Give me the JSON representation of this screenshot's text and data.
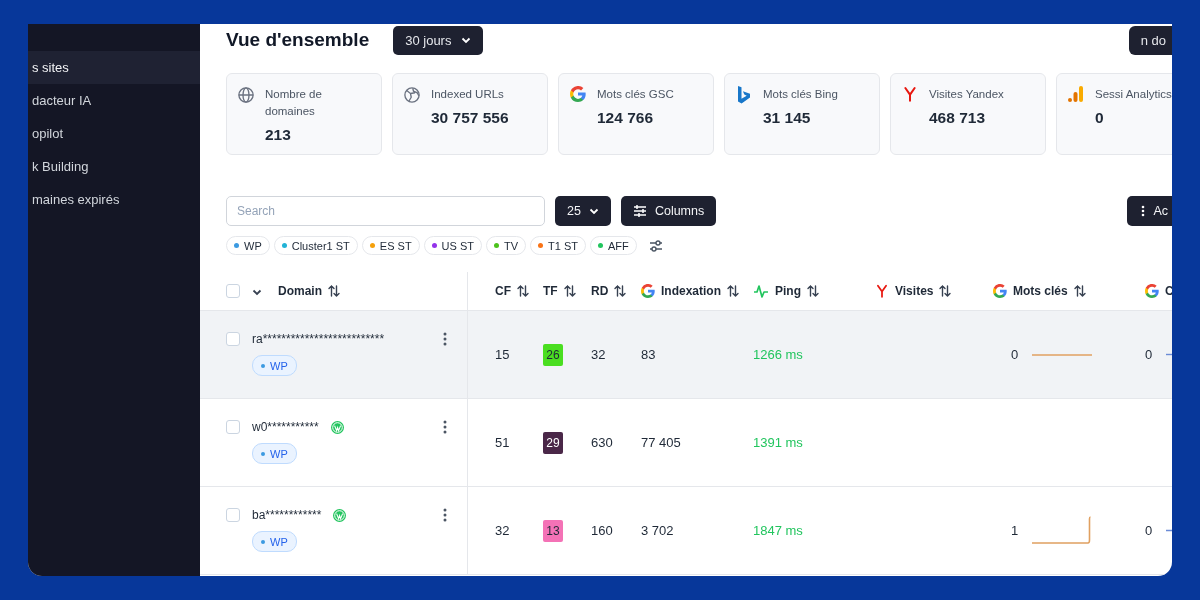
{
  "sidebar": {
    "items": [
      {
        "label": "s sites",
        "selected": true
      },
      {
        "label": "dacteur IA",
        "selected": false
      },
      {
        "label": "opilot",
        "selected": false
      },
      {
        "label": "k Building",
        "selected": false
      },
      {
        "label": "maines expirés",
        "selected": false
      }
    ]
  },
  "header": {
    "title": "Vue d'ensemble",
    "period": "30 jours",
    "right_button": "n do"
  },
  "stats": [
    {
      "kind": "globe",
      "label": "Nombre de domaines",
      "value": "213"
    },
    {
      "kind": "web",
      "label": "Indexed URLs",
      "value": "30 757 556"
    },
    {
      "kind": "google",
      "label": "Mots clés GSC",
      "value": "124 766"
    },
    {
      "kind": "bing",
      "label": "Mots clés Bing",
      "value": "31 145"
    },
    {
      "kind": "yandex",
      "label": "Visites Yandex",
      "value": "468 713"
    },
    {
      "kind": "analytics",
      "label": "Sessi Analytics",
      "value": "0"
    }
  ],
  "toolbar": {
    "search_placeholder": "Search",
    "page_size": "25",
    "columns_button": "Columns",
    "actions_button": "Ac"
  },
  "tags": [
    {
      "label": "WP",
      "color": "#3b9ae1"
    },
    {
      "label": "Cluster1 ST",
      "color": "#22b3d6"
    },
    {
      "label": "ES ST",
      "color": "#f5a00b"
    },
    {
      "label": "US ST",
      "color": "#9333ea"
    },
    {
      "label": "TV",
      "color": "#4cc21c"
    },
    {
      "label": "T1 ST",
      "color": "#f97316"
    },
    {
      "label": "AFF",
      "color": "#22c55e"
    }
  ],
  "table": {
    "header_checked": false,
    "columns": [
      {
        "label": "Domain",
        "kind": "plain"
      },
      {
        "label": "CF",
        "kind": "plain"
      },
      {
        "label": "TF",
        "kind": "plain"
      },
      {
        "label": "RD",
        "kind": "plain"
      },
      {
        "label": "Indexation",
        "kind": "google"
      },
      {
        "label": "Ping",
        "kind": "pulse"
      },
      {
        "label": "Visites",
        "kind": "yandex"
      },
      {
        "label": "Mots clés",
        "kind": "google"
      },
      {
        "label": "C",
        "kind": "google"
      }
    ],
    "rows": [
      {
        "checked": false,
        "hovered": true,
        "domain": "ra**************************",
        "wordpress": false,
        "tag": {
          "label": "WP",
          "color": "#3b9ae1"
        },
        "cf": "15",
        "tf": {
          "value": "26",
          "color": "#4ade20"
        },
        "rd": "32",
        "indexation": "83",
        "ping": "1266 ms",
        "keywords": {
          "value": "0",
          "kind": "flat"
        },
        "column_9": "0"
      },
      {
        "checked": false,
        "hovered": false,
        "domain": "w0***********",
        "wordpress": true,
        "tag": {
          "label": "WP",
          "color": "#3b9ae1"
        },
        "cf": "51",
        "tf": {
          "value": "29",
          "color": "#4a2748"
        },
        "rd": "630",
        "indexation": "77 405",
        "ping": "1391 ms"
      },
      {
        "checked": false,
        "hovered": false,
        "domain": "ba************",
        "wordpress": true,
        "tag": {
          "label": "WP",
          "color": "#3b9ae1"
        },
        "cf": "32",
        "tf": {
          "value": "13",
          "color": "#f472b6"
        },
        "rd": "160",
        "indexation": "3 702",
        "ping": "1847 ms",
        "keywords": {
          "value": "1",
          "kind": "step"
        },
        "column_9": "0"
      }
    ]
  }
}
